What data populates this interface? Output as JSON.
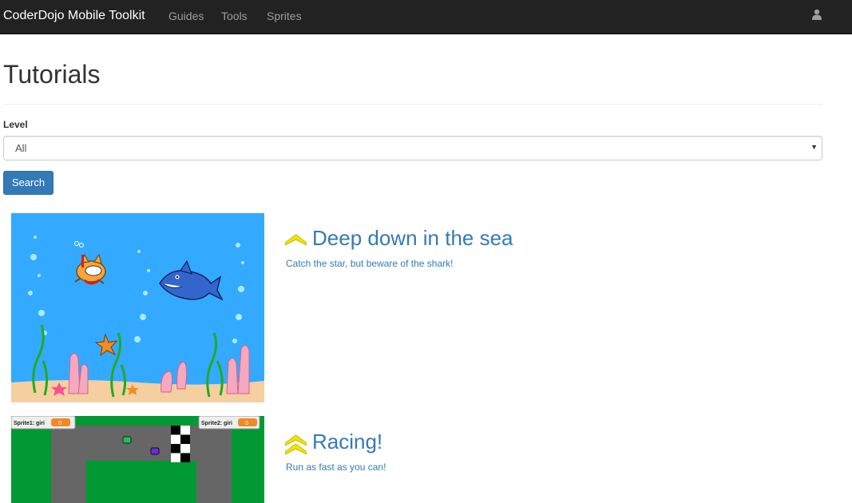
{
  "navbar": {
    "brand": "CoderDojo Mobile Toolkit",
    "links": [
      "Guides",
      "Tools",
      "Sprites"
    ],
    "user_icon": "user-icon"
  },
  "page": {
    "title": "Tutorials",
    "level_label": "Level",
    "level_select_value": "All",
    "search_button": "Search"
  },
  "tutorials": [
    {
      "title": "Deep down in the sea",
      "description": "Catch the star, but beware of the shark!",
      "level_icon": "single-chevron-up-icon",
      "level_color": "#f2e600"
    },
    {
      "title": "Racing!",
      "description": "Run as fast as you can!",
      "level_icon": "double-chevron-up-icon",
      "level_color": "#f2e600",
      "thumbnail": {
        "sprite1_label": "Sprite1: giri",
        "sprite1_value": "0",
        "sprite2_label": "Sprite2: giri",
        "sprite2_value": "0"
      }
    }
  ],
  "colors": {
    "navbar_bg": "#222222",
    "link": "#337ab7",
    "button": "#337ab7",
    "sea": "#33aaff",
    "grass": "#009933",
    "road": "#666666"
  }
}
